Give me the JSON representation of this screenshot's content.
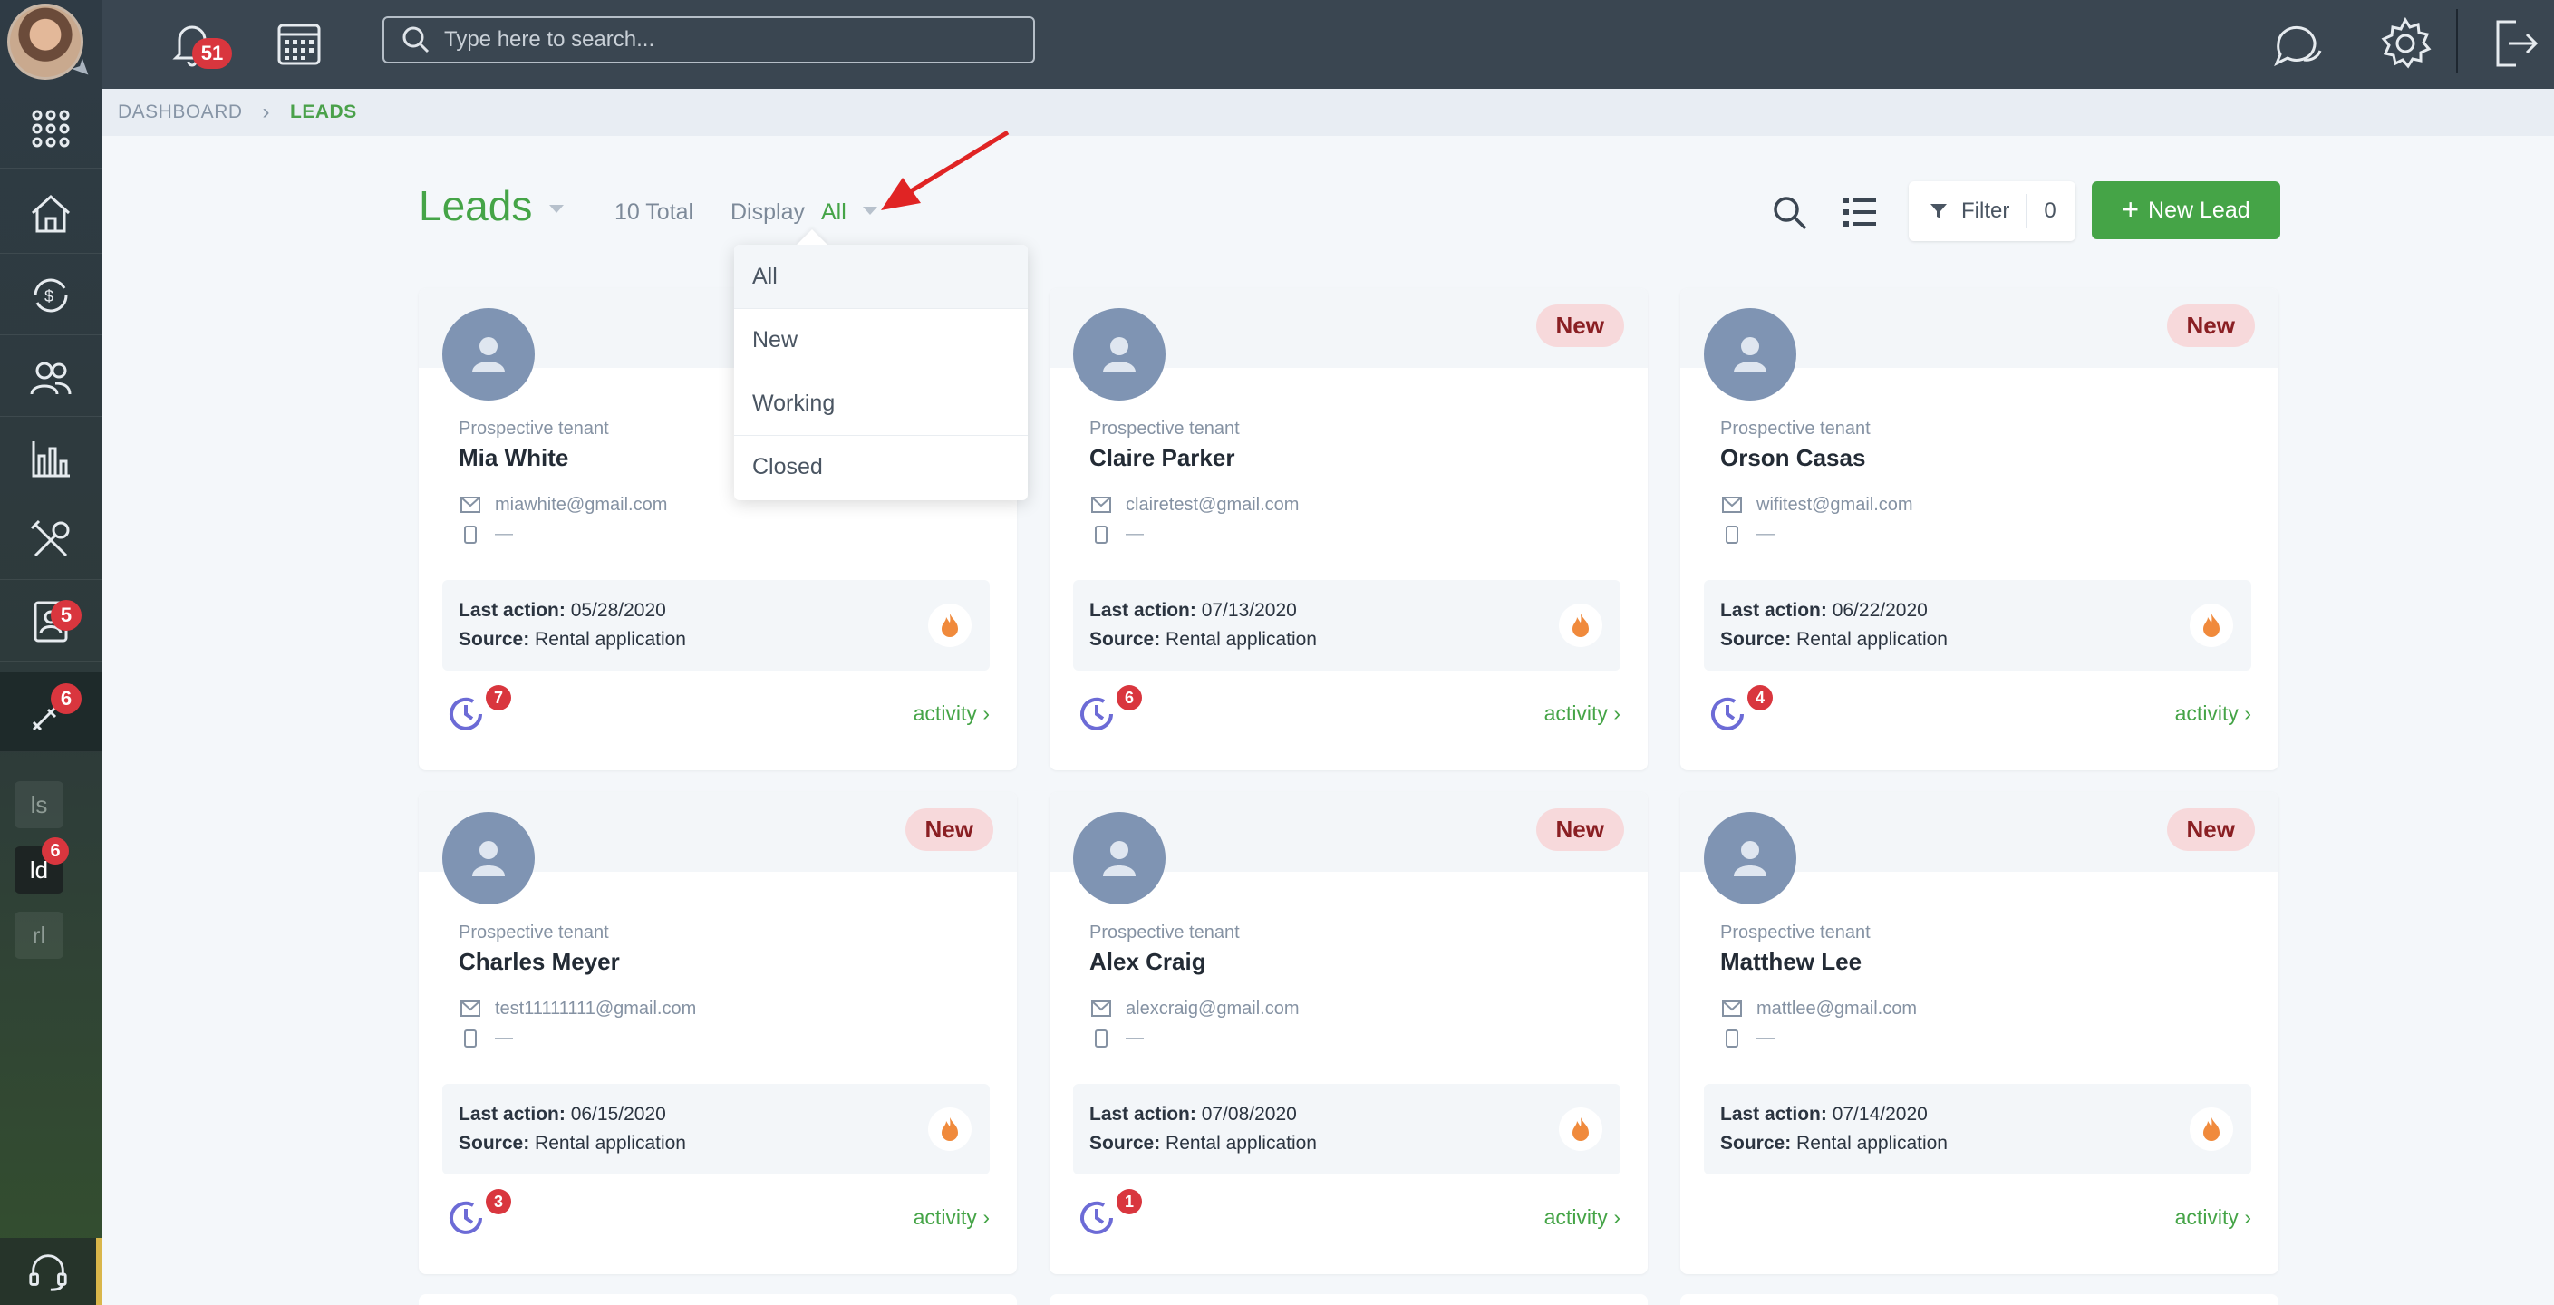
{
  "topbar": {
    "notifications_count": "51",
    "search_placeholder": "Type here to search..."
  },
  "sidebar": {
    "badges": {
      "reports": "5",
      "leads": "6",
      "mini_ld": "6"
    },
    "mini_items": [
      "ls",
      "ld",
      "rl"
    ]
  },
  "breadcrumb": {
    "root": "DASHBOARD",
    "current": "LEADS"
  },
  "header": {
    "title": "Leads",
    "total": "10 Total",
    "display_label": "Display",
    "display_value": "All",
    "filter_label": "Filter",
    "filter_count": "0",
    "new_lead_label": "New Lead"
  },
  "dropdown": {
    "options": [
      "All",
      "New",
      "Working",
      "Closed"
    ]
  },
  "card_labels": {
    "role": "Prospective tenant",
    "last_action": "Last action:",
    "source": "Source:",
    "activity": "activity",
    "new_badge": "New",
    "phone_placeholder": "—"
  },
  "cards": [
    {
      "name": "Mia White",
      "email": "miawhite@gmail.com",
      "last_action": "05/28/2020",
      "source": "Rental application",
      "activity_count": "7"
    },
    {
      "name": "Claire Parker",
      "email": "clairetest@gmail.com",
      "last_action": "07/13/2020",
      "source": "Rental application",
      "activity_count": "6"
    },
    {
      "name": "Orson Casas",
      "email": "wifitest@gmail.com",
      "last_action": "06/22/2020",
      "source": "Rental application",
      "activity_count": "4"
    },
    {
      "name": "Charles Meyer",
      "email": "test11111111@gmail.com",
      "last_action": "06/15/2020",
      "source": "Rental application",
      "activity_count": "3"
    },
    {
      "name": "Alex Craig",
      "email": "alexcraig@gmail.com",
      "last_action": "07/08/2020",
      "source": "Rental application",
      "activity_count": "1"
    },
    {
      "name": "Matthew Lee",
      "email": "mattlee@gmail.com",
      "last_action": "07/14/2020",
      "source": "Rental application",
      "activity_count": ""
    }
  ],
  "colors": {
    "brand_green": "#45a447",
    "badge_red": "#d9363e",
    "sidebar_dark": "#2f3b45"
  }
}
